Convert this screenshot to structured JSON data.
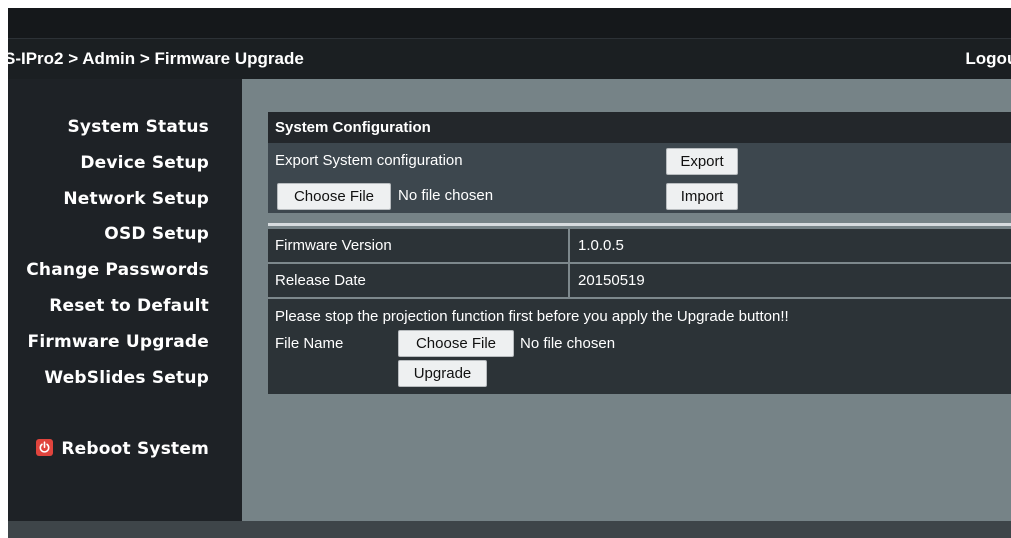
{
  "header": {
    "breadcrumb_lead": "S-IPro2",
    "breadcrumb_sep1": " > ",
    "breadcrumb_admin": "Admin",
    "breadcrumb_sep2": " > ",
    "breadcrumb_page": "Firmware Upgrade",
    "logout_label": "Logout"
  },
  "sidebar": {
    "items": [
      {
        "label": "System Status"
      },
      {
        "label": "Device Setup"
      },
      {
        "label": "Network Setup"
      },
      {
        "label": "OSD Setup"
      },
      {
        "label": "Change Passwords"
      },
      {
        "label": "Reset to Default"
      },
      {
        "label": "Firmware Upgrade"
      },
      {
        "label": "WebSlides Setup"
      }
    ],
    "reboot": {
      "label": "Reboot System",
      "icon": "power-icon",
      "color": "#e0443d"
    }
  },
  "config": {
    "title": "System Configuration",
    "export_label": "Export System configuration",
    "export_button": "Export",
    "choose_file_button": "Choose File",
    "no_file": "No file chosen",
    "import_button": "Import"
  },
  "info": {
    "firmware_label": "Firmware Version",
    "firmware_value": "1.0.0.5",
    "release_label": "Release Date",
    "release_value": "20150519"
  },
  "upgrade": {
    "notice": "Please stop the projection function first before you apply the Upgrade button!!",
    "file_name_label": "File Name",
    "choose_file_button": "Choose File",
    "no_file": "No file chosen",
    "upgrade_button": "Upgrade"
  }
}
